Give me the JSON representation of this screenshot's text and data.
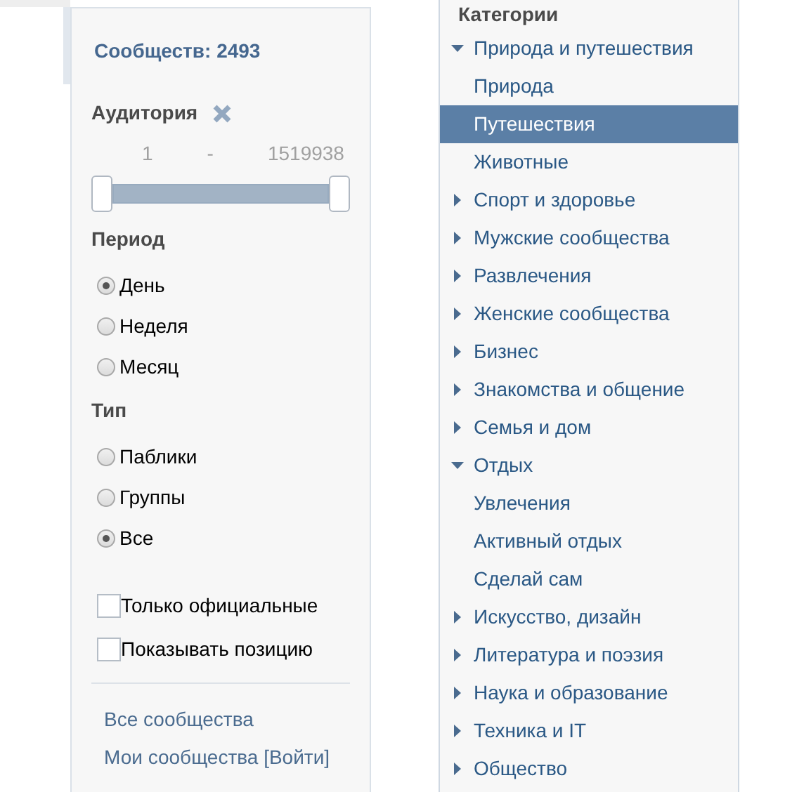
{
  "filters": {
    "count_title": "Сообществ: 2493",
    "audience": {
      "label": "Аудитория",
      "from": "1",
      "separator": "-",
      "to": "1519938",
      "level": 1
    },
    "period": {
      "label": "Период",
      "options": [
        {
          "label": "День",
          "selected": true
        },
        {
          "label": "Неделя",
          "selected": false
        },
        {
          "label": "Месяц",
          "selected": false
        }
      ]
    },
    "type": {
      "label": "Тип",
      "options": [
        {
          "label": "Паблики",
          "selected": false
        },
        {
          "label": "Группы",
          "selected": false
        },
        {
          "label": "Все",
          "selected": true
        }
      ]
    },
    "checkboxes": [
      {
        "label": "Только официальные",
        "checked": false
      },
      {
        "label": "Показывать позицию",
        "checked": false
      }
    ],
    "links": [
      "Все сообщества",
      "Мои сообщества [Войти]"
    ]
  },
  "categories": {
    "title": "Категории",
    "items": [
      {
        "label": "Природа и путешествия",
        "expanded": true,
        "selected": false,
        "children": [
          {
            "label": "Природа",
            "selected": false
          },
          {
            "label": "Путешествия",
            "selected": true
          },
          {
            "label": "Животные",
            "selected": false
          }
        ]
      },
      {
        "label": "Спорт и здоровье",
        "expanded": false,
        "selected": false
      },
      {
        "label": "Мужские сообщества",
        "expanded": false,
        "selected": false
      },
      {
        "label": "Развлечения",
        "expanded": false,
        "selected": false
      },
      {
        "label": "Женские сообщества",
        "expanded": false,
        "selected": false
      },
      {
        "label": "Бизнес",
        "expanded": false,
        "selected": false
      },
      {
        "label": "Знакомства и общение",
        "expanded": false,
        "selected": false
      },
      {
        "label": "Семья и дом",
        "expanded": false,
        "selected": false
      },
      {
        "label": "Отдых",
        "expanded": true,
        "selected": false,
        "children": [
          {
            "label": "Увлечения",
            "selected": false
          },
          {
            "label": "Активный отдых",
            "selected": false
          },
          {
            "label": "Сделай сам",
            "selected": false
          }
        ]
      },
      {
        "label": "Искусство, дизайн",
        "expanded": false,
        "selected": false
      },
      {
        "label": "Литература и поэзия",
        "expanded": false,
        "selected": false
      },
      {
        "label": "Наука и образование",
        "expanded": false,
        "selected": false
      },
      {
        "label": "Техника и IT",
        "expanded": false,
        "selected": false
      },
      {
        "label": "Общество",
        "expanded": false,
        "selected": false
      }
    ]
  }
}
